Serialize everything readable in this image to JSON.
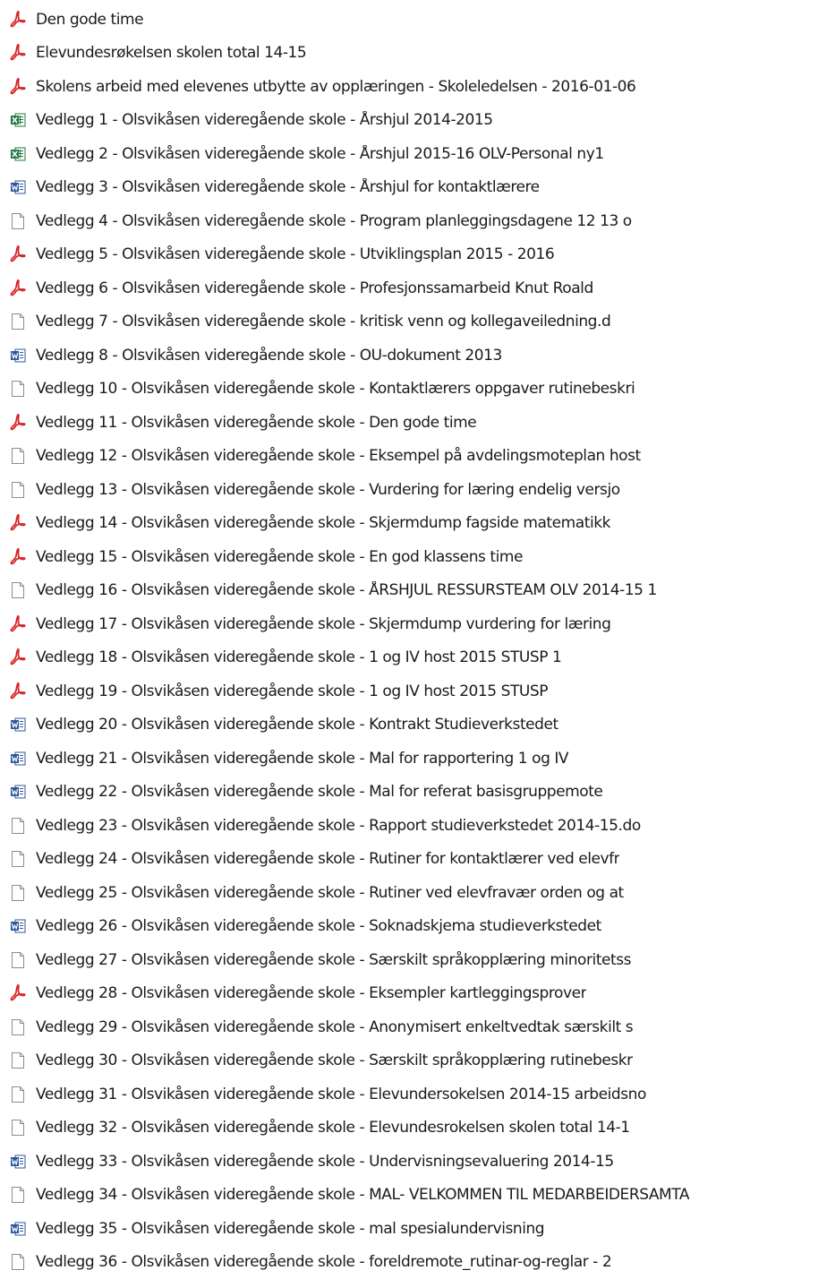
{
  "files": [
    {
      "name": "Den gode time",
      "type": "pdf",
      "icon": "pdf-file-icon"
    },
    {
      "name": "Elevundesrøkelsen skolen total 14-15",
      "type": "pdf",
      "icon": "pdf-file-icon"
    },
    {
      "name": "Skolens arbeid med elevenes utbytte av opplæringen  - Skoleledelsen - 2016-01-06",
      "type": "pdf",
      "icon": "pdf-file-icon"
    },
    {
      "name": "Vedlegg 1 - Olsvikåsen videregående skole - Årshjul 2014-2015",
      "type": "excel",
      "icon": "excel-file-icon"
    },
    {
      "name": "Vedlegg 2 - Olsvikåsen videregående skole - Årshjul 2015-16 OLV-Personal ny1",
      "type": "excel",
      "icon": "excel-file-icon"
    },
    {
      "name": "Vedlegg 3 - Olsvikåsen videregående skole - Årshjul for kontaktlærere",
      "type": "word",
      "icon": "word-file-icon"
    },
    {
      "name": "Vedlegg 4 - Olsvikåsen videregående skole - Program planleggingsdagene 12   13 o",
      "type": "generic",
      "icon": "blank-file-icon"
    },
    {
      "name": "Vedlegg 5 - Olsvikåsen videregående skole - Utviklingsplan 2015 - 2016",
      "type": "pdf",
      "icon": "pdf-file-icon"
    },
    {
      "name": "Vedlegg 6 - Olsvikåsen videregående skole - Profesjonssamarbeid Knut Roald",
      "type": "pdf",
      "icon": "pdf-file-icon"
    },
    {
      "name": "Vedlegg 7 - Olsvikåsen videregående skole - kritisk venn  og kollegaveiledning.d",
      "type": "generic",
      "icon": "blank-file-icon"
    },
    {
      "name": "Vedlegg 8 - Olsvikåsen videregående skole - OU-dokument 2013",
      "type": "word",
      "icon": "word-file-icon"
    },
    {
      "name": "Vedlegg 10 - Olsvikåsen videregående skole - Kontaktlærers oppgaver rutinebeskri",
      "type": "generic",
      "icon": "blank-file-icon"
    },
    {
      "name": "Vedlegg 11 - Olsvikåsen videregående skole - Den gode time",
      "type": "pdf",
      "icon": "pdf-file-icon"
    },
    {
      "name": "Vedlegg 12 - Olsvikåsen videregående skole - Eksempel på avdelingsmoteplan host",
      "type": "generic",
      "icon": "blank-file-icon"
    },
    {
      "name": "Vedlegg 13 - Olsvikåsen videregående skole - Vurdering for læring endelig versjo",
      "type": "generic",
      "icon": "blank-file-icon"
    },
    {
      "name": "Vedlegg 14 - Olsvikåsen videregående skole - Skjermdump fagside matematikk",
      "type": "pdf",
      "icon": "pdf-file-icon"
    },
    {
      "name": "Vedlegg 15 - Olsvikåsen videregående skole - En god klassens time",
      "type": "pdf",
      "icon": "pdf-file-icon"
    },
    {
      "name": "Vedlegg 16 - Olsvikåsen videregående skole - ÅRSHJUL RESSURSTEAM OLV 2014-15  1",
      "type": "generic",
      "icon": "blank-file-icon"
    },
    {
      "name": "Vedlegg 17 - Olsvikåsen videregående skole - Skjermdump vurdering for læring",
      "type": "pdf",
      "icon": "pdf-file-icon"
    },
    {
      "name": "Vedlegg 18 - Olsvikåsen videregående skole - 1 og IV host 2015 STUSP  1",
      "type": "pdf",
      "icon": "pdf-file-icon"
    },
    {
      "name": "Vedlegg 19 - Olsvikåsen videregående skole - 1 og IV host 2015 STUSP",
      "type": "pdf",
      "icon": "pdf-file-icon"
    },
    {
      "name": "Vedlegg 20 - Olsvikåsen videregående skole - Kontrakt Studieverkstedet",
      "type": "word",
      "icon": "word-file-icon"
    },
    {
      "name": "Vedlegg 21 - Olsvikåsen videregående skole - Mal for rapportering 1 og IV",
      "type": "word",
      "icon": "word-file-icon"
    },
    {
      "name": "Vedlegg 22 - Olsvikåsen videregående skole - Mal for referat basisgruppemote",
      "type": "word",
      "icon": "word-file-icon"
    },
    {
      "name": "Vedlegg 23 - Olsvikåsen videregående skole - Rapport studieverkstedet 2014-15.do",
      "type": "generic",
      "icon": "blank-file-icon"
    },
    {
      "name": "Vedlegg 24 - Olsvikåsen videregående skole - Rutiner for kontaktlærer ved elevfr",
      "type": "generic",
      "icon": "blank-file-icon"
    },
    {
      "name": "Vedlegg 25 - Olsvikåsen videregående skole - Rutiner ved elevfravær  orden og at",
      "type": "generic",
      "icon": "blank-file-icon"
    },
    {
      "name": "Vedlegg 26 - Olsvikåsen videregående skole - Soknadskjema studieverkstedet",
      "type": "word",
      "icon": "word-file-icon"
    },
    {
      "name": "Vedlegg 27 - Olsvikåsen videregående skole - Særskilt språkopplæring minoritetss",
      "type": "generic",
      "icon": "blank-file-icon"
    },
    {
      "name": "Vedlegg 28 - Olsvikåsen videregående skole - Eksempler kartleggingsprover",
      "type": "pdf",
      "icon": "pdf-file-icon"
    },
    {
      "name": "Vedlegg 29 - Olsvikåsen videregående skole - Anonymisert enkeltvedtak særskilt s",
      "type": "generic",
      "icon": "blank-file-icon"
    },
    {
      "name": "Vedlegg 30 - Olsvikåsen videregående skole - Særskilt språkopplæring rutinebeskr",
      "type": "generic",
      "icon": "blank-file-icon"
    },
    {
      "name": "Vedlegg 31 - Olsvikåsen videregående skole - Elevundersokelsen 2014-15 arbeidsno",
      "type": "generic",
      "icon": "blank-file-icon"
    },
    {
      "name": "Vedlegg 32 - Olsvikåsen videregående skole - Elevundesrokelsen skolen total 14-1",
      "type": "generic",
      "icon": "blank-file-icon"
    },
    {
      "name": "Vedlegg 33 - Olsvikåsen videregående skole - Undervisningsevaluering 2014-15",
      "type": "word",
      "icon": "word-file-icon"
    },
    {
      "name": "Vedlegg 34 - Olsvikåsen videregående skole - MAL- VELKOMMEN TIL MEDARBEIDERSAMTA",
      "type": "generic",
      "icon": "blank-file-icon"
    },
    {
      "name": "Vedlegg 35 - Olsvikåsen videregående skole - mal spesialundervisning",
      "type": "word",
      "icon": "word-file-icon"
    },
    {
      "name": "Vedlegg 36 - Olsvikåsen videregående skole - foreldremote_rutinar-og-reglar  - 2",
      "type": "generic",
      "icon": "blank-file-icon"
    }
  ],
  "colors": {
    "pdf": "#d9262a",
    "excel": "#1f7a3e",
    "word": "#2b579a",
    "generic_border": "#8c8c8c"
  }
}
